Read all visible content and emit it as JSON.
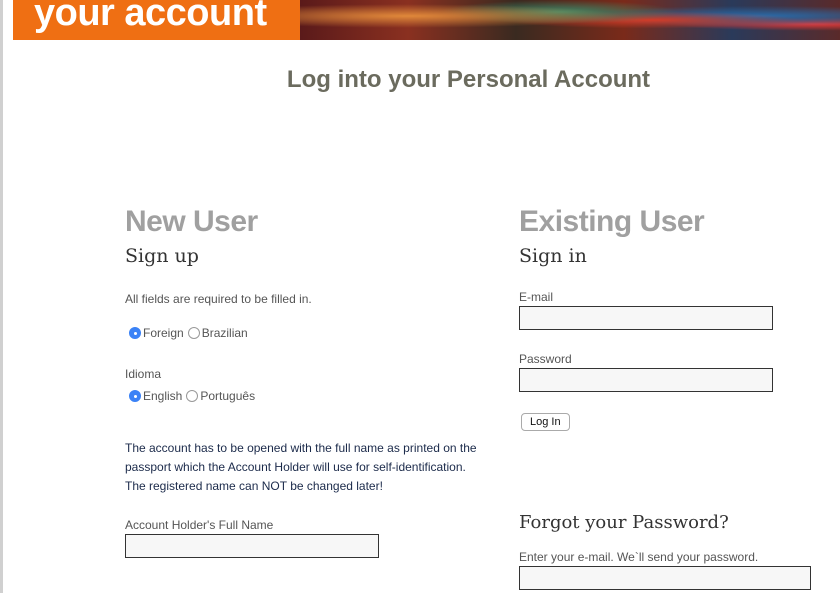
{
  "banner": {
    "text": "your account"
  },
  "page_title": "Log into your Personal Account",
  "new_user": {
    "heading": "New User",
    "subheading": "Sign up",
    "required_note": "All fields are required to be filled in.",
    "residency_options": [
      {
        "label": "Foreign",
        "selected": true
      },
      {
        "label": "Brazilian",
        "selected": false
      }
    ],
    "language_label": "Idioma",
    "language_options": [
      {
        "label": "English",
        "selected": true
      },
      {
        "label": "Português",
        "selected": false
      }
    ],
    "notice_lines": [
      "The account has to be opened with the full name as printed on the",
      "passport which the Account Holder will use for self-identification.",
      "The registered name can NOT be changed later!"
    ],
    "full_name_label": "Account Holder's Full Name",
    "full_name_value": ""
  },
  "existing_user": {
    "heading": "Existing User",
    "subheading": "Sign in",
    "email_label": "E-mail",
    "email_value": "",
    "password_label": "Password",
    "password_value": "",
    "login_button": "Log In"
  },
  "forgot": {
    "heading": "Forgot your Password?",
    "hint": "Enter your e-mail. We`ll send your password.",
    "email_value": ""
  },
  "colors": {
    "banner_orange": "#ef6f13",
    "radio_selected": "#3b82f6",
    "title": "#6b6b5e"
  }
}
